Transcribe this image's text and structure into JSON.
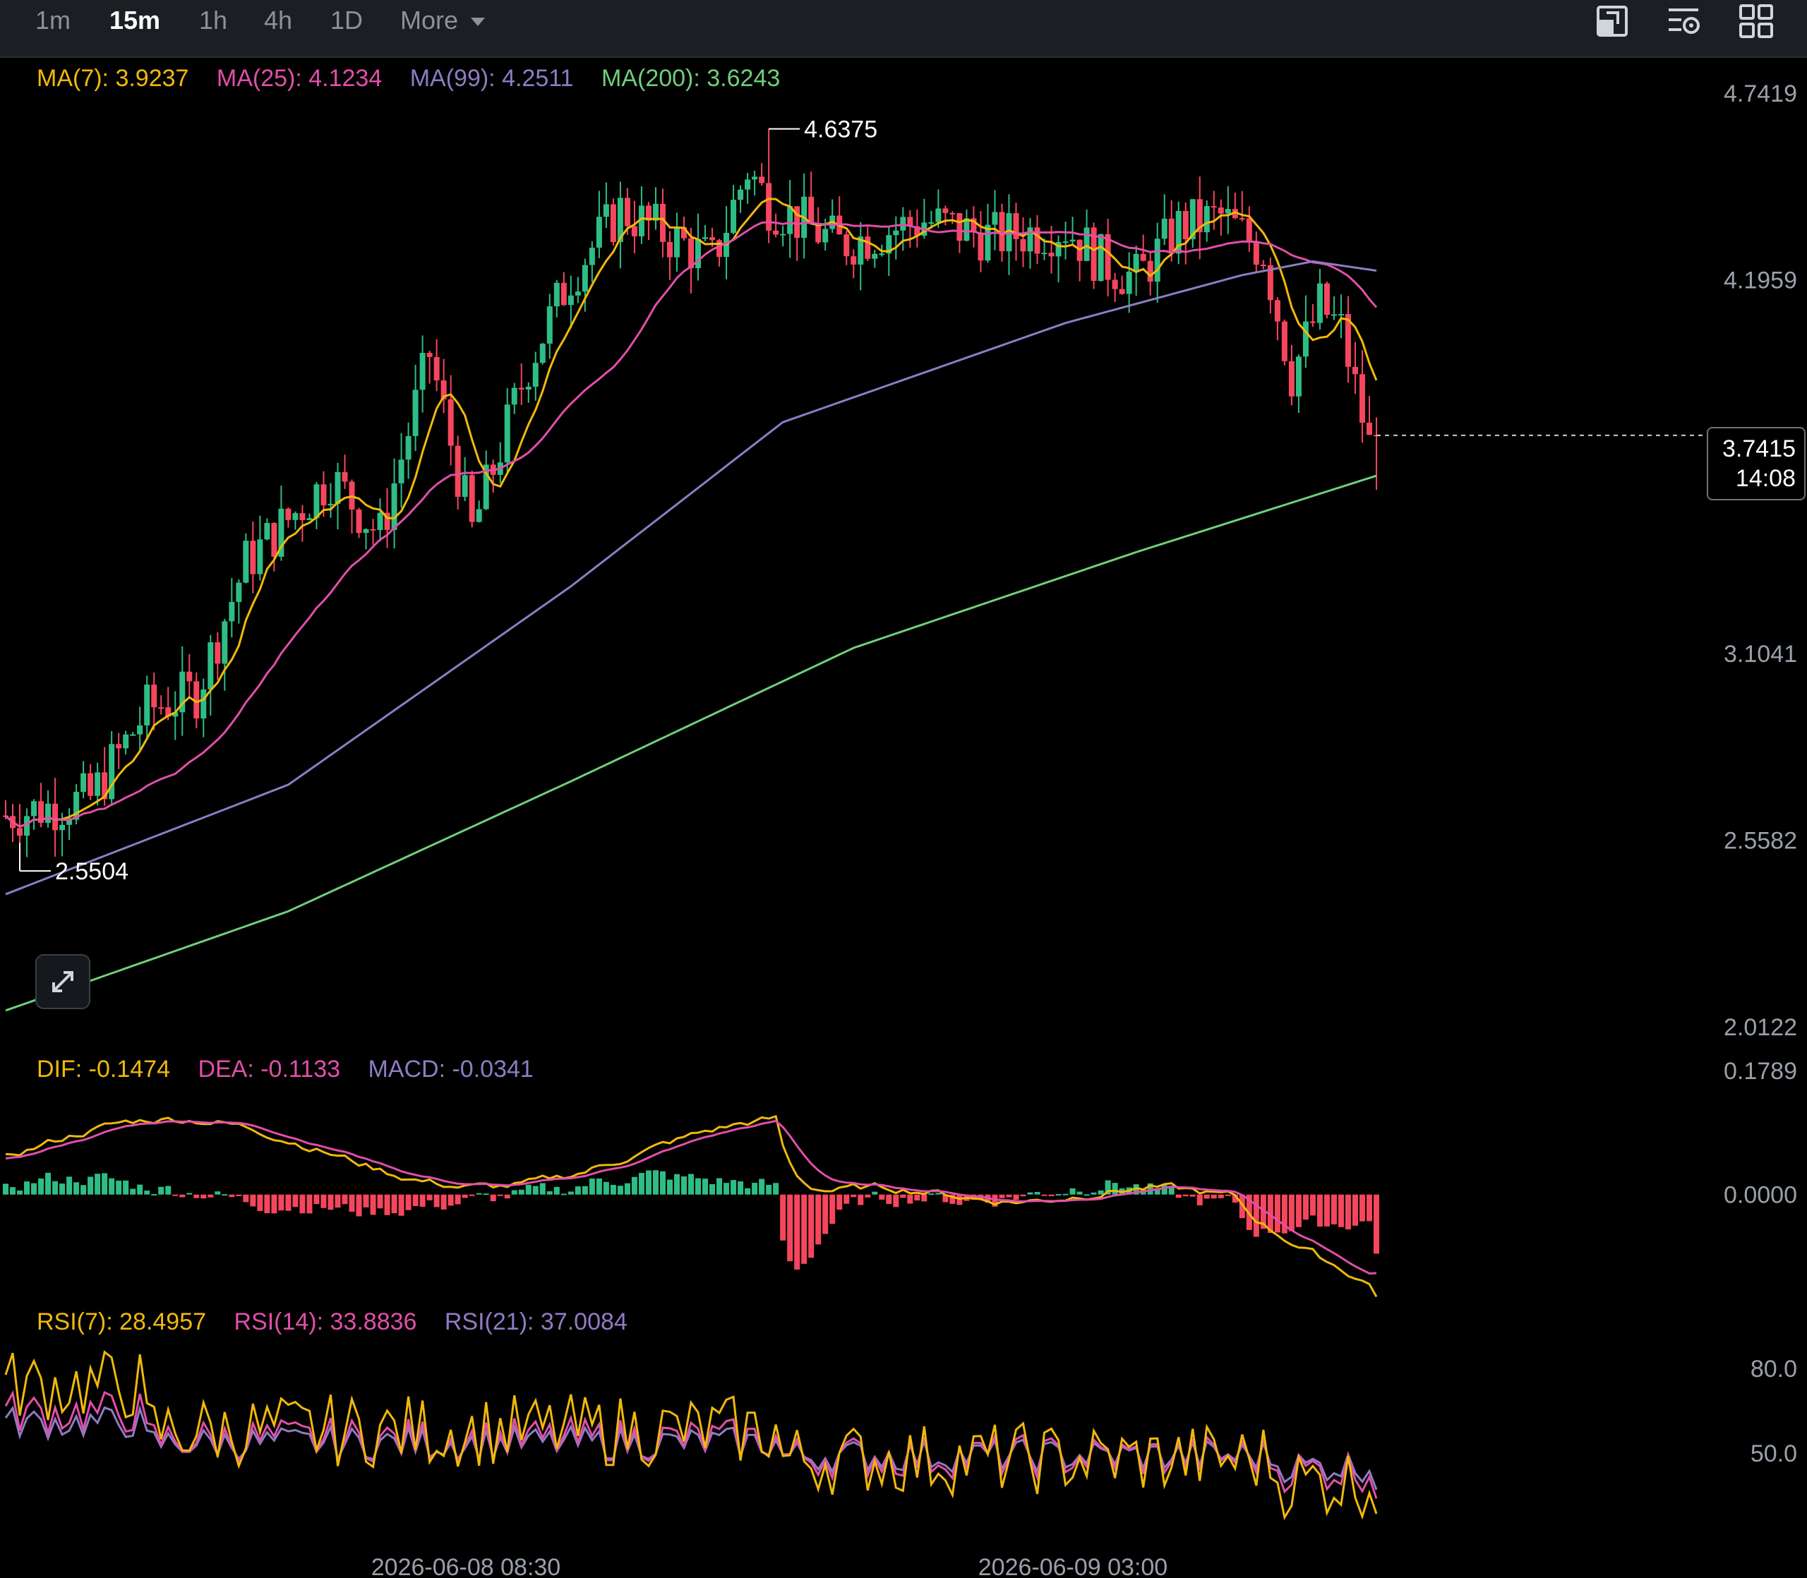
{
  "toolbar": {
    "timeframes": [
      "1m",
      "15m",
      "1h",
      "4h",
      "1D"
    ],
    "active": "15m",
    "more_label": "More"
  },
  "legend": {
    "ma7": "MA(7): 3.9237",
    "ma25": "MA(25): 4.1234",
    "ma99": "MA(99): 4.2511",
    "ma200": "MA(200): 3.6243",
    "dif": "DIF: -0.1474",
    "dea": "DEA: -0.1133",
    "macd": "MACD: -0.0341",
    "rsi7": "RSI(7): 28.4957",
    "rsi14": "RSI(14): 33.8836",
    "rsi21": "RSI(21): 37.0084"
  },
  "price_axis": [
    "4.7419",
    "4.1959",
    "3.1041",
    "2.5582",
    "2.0122"
  ],
  "macd_axis": [
    "0.1789",
    "0.0000"
  ],
  "rsi_axis": [
    "80.0",
    "50.0"
  ],
  "current_price": "3.7415",
  "countdown": "14:08",
  "high_label": "4.6375",
  "low_label": "2.5504",
  "x_axis": [
    "2026-06-08 08:30",
    "2026-06-09 03:00"
  ],
  "colors": {
    "up": "#2ebd85",
    "down": "#f6465d",
    "ma7": "#f0b90b",
    "ma25": "#e04fa8",
    "ma99": "#8e7cc3",
    "ma200": "#6fcf7b"
  },
  "chart_data": {
    "type": "candlestick",
    "title": "",
    "interval": "15m",
    "candle_count": 195,
    "price_range": [
      2.0122,
      4.7419
    ],
    "high": 4.6375,
    "low": 2.5504,
    "last": 3.7415,
    "price_path": [
      [
        0,
        2.63
      ],
      [
        12,
        2.68
      ],
      [
        20,
        2.94
      ],
      [
        27,
        2.99
      ],
      [
        34,
        3.37
      ],
      [
        46,
        3.62
      ],
      [
        53,
        3.45
      ],
      [
        60,
        3.98
      ],
      [
        66,
        3.46
      ],
      [
        74,
        3.95
      ],
      [
        80,
        4.21
      ],
      [
        87,
        4.4
      ],
      [
        96,
        4.3
      ],
      [
        100,
        4.25
      ],
      [
        105,
        4.52
      ],
      [
        108,
        4.42
      ],
      [
        118,
        4.3
      ],
      [
        130,
        4.37
      ],
      [
        140,
        4.32
      ],
      [
        150,
        4.35
      ],
      [
        155,
        4.25
      ],
      [
        160,
        4.2
      ],
      [
        166,
        4.35
      ],
      [
        172,
        4.38
      ],
      [
        178,
        4.28
      ],
      [
        182,
        3.92
      ],
      [
        186,
        4.12
      ],
      [
        189,
        4.05
      ],
      [
        193,
        3.71
      ],
      [
        195,
        3.74
      ]
    ],
    "ma_series": [
      {
        "name": "MA(7)",
        "last": 3.9237
      },
      {
        "name": "MA(25)",
        "last": 4.1234
      },
      {
        "name": "MA(99)",
        "points": [
          [
            0,
            2.4
          ],
          [
            40,
            2.72
          ],
          [
            80,
            3.3
          ],
          [
            110,
            3.78
          ],
          [
            150,
            4.07
          ],
          [
            175,
            4.21
          ],
          [
            185,
            4.25
          ],
          [
            195,
            4.22
          ]
        ]
      },
      {
        "name": "MA(200)",
        "points": [
          [
            0,
            2.06
          ],
          [
            40,
            2.35
          ],
          [
            80,
            2.73
          ],
          [
            120,
            3.12
          ],
          [
            160,
            3.4
          ],
          [
            195,
            3.63
          ]
        ]
      }
    ],
    "macd": {
      "dif": -0.1474,
      "dea": -0.1133,
      "hist": -0.0341,
      "range": [
        -0.15,
        0.1789
      ]
    },
    "rsi": {
      "rsi7": 28.4957,
      "rsi14": 33.8836,
      "rsi21": 37.0084
    }
  }
}
